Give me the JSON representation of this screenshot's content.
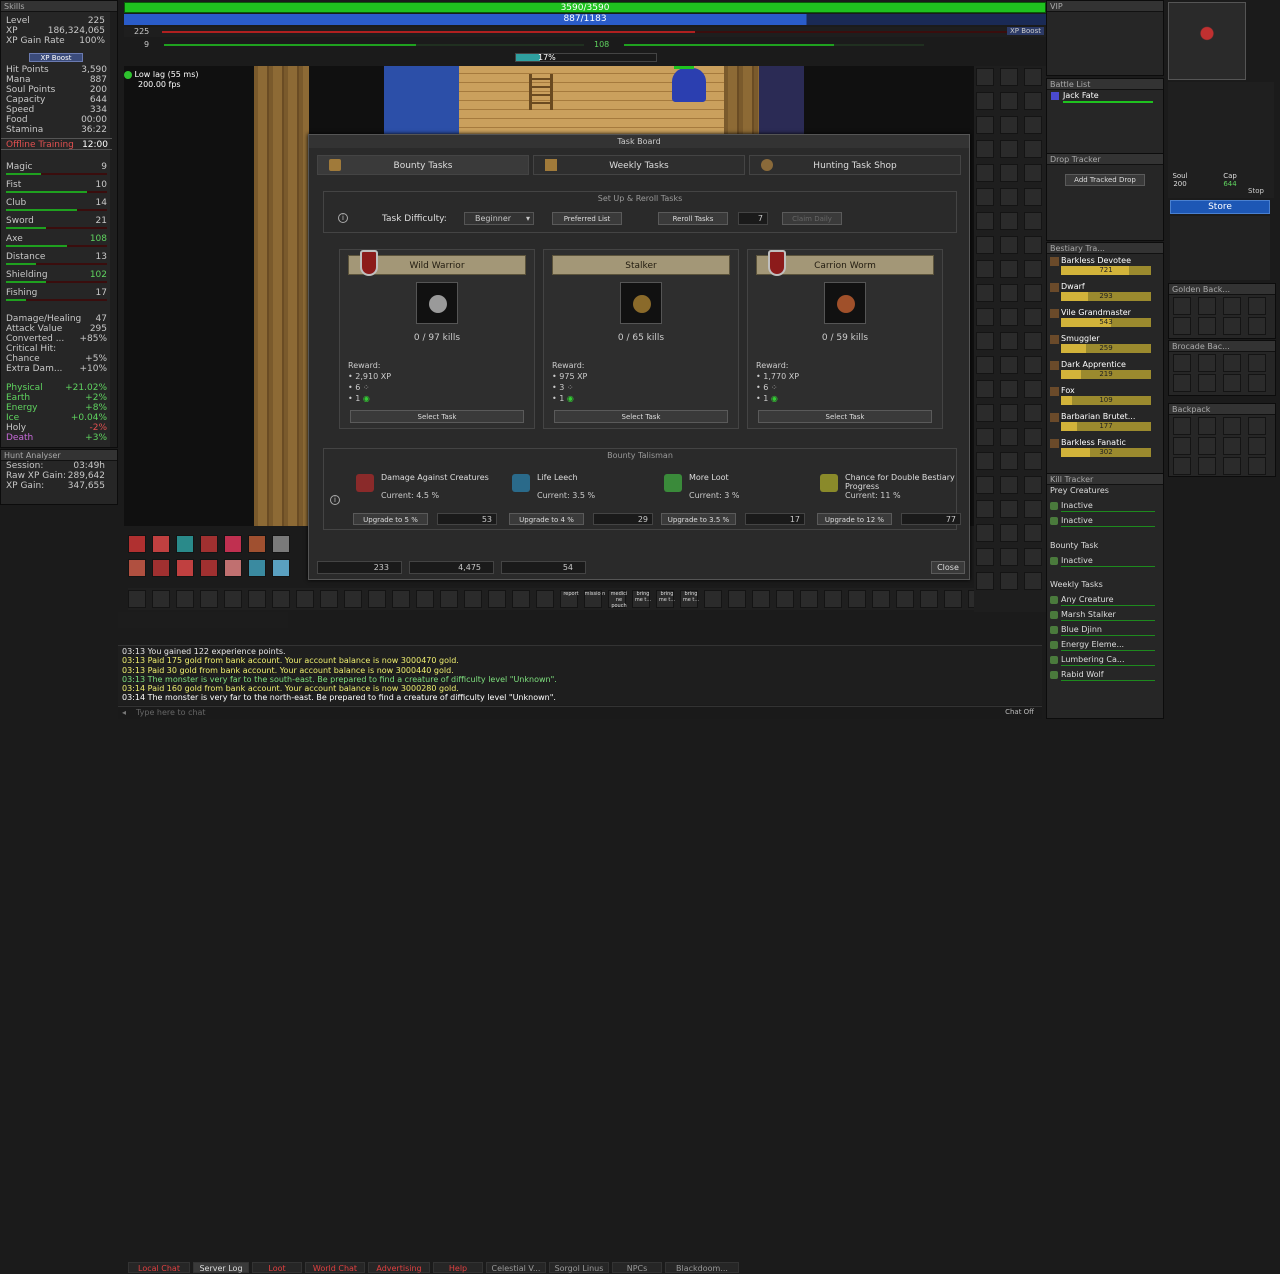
{
  "skills": {
    "title": "Skills",
    "top": [
      {
        "k": "Level",
        "v": "225"
      },
      {
        "k": "XP",
        "v": "186,324,065"
      },
      {
        "k": "XP Gain Rate",
        "v": "100%"
      }
    ],
    "xp_boost": "XP Boost",
    "stats": [
      {
        "k": "Hit Points",
        "v": "3,590"
      },
      {
        "k": "Mana",
        "v": "887"
      },
      {
        "k": "Soul Points",
        "v": "200"
      },
      {
        "k": "Capacity",
        "v": "644"
      },
      {
        "k": "Speed",
        "v": "334"
      },
      {
        "k": "Food",
        "v": "00:00"
      },
      {
        "k": "Stamina",
        "v": "36:22"
      }
    ],
    "offline": {
      "k": "Offline Training",
      "v": "12:00"
    },
    "fighting": [
      {
        "k": "Magic",
        "v": "9",
        "p": 0.35
      },
      {
        "k": "Fist",
        "v": "10",
        "p": 0.8
      },
      {
        "k": "Club",
        "v": "14",
        "p": 0.7
      },
      {
        "k": "Sword",
        "v": "21",
        "p": 0.4
      },
      {
        "k": "Axe",
        "v": "108",
        "p": 0.6
      },
      {
        "k": "Distance",
        "v": "13",
        "p": 0.3
      },
      {
        "k": "Shielding",
        "v": "102",
        "p": 0.4
      },
      {
        "k": "Fishing",
        "v": "17",
        "p": 0.2
      }
    ],
    "combat": [
      {
        "k": "Damage/Healing",
        "v": "47"
      },
      {
        "k": "Attack Value",
        "v": "295"
      },
      {
        "k": "Converted ...",
        "v": "+85%"
      },
      {
        "k": "Critical Hit:",
        "v": ""
      },
      {
        "k": "  Chance",
        "v": "+5%"
      },
      {
        "k": "  Extra Dam...",
        "v": "+10%"
      }
    ],
    "resist": [
      {
        "k": "Physical",
        "v": "+21.02%"
      },
      {
        "k": "Earth",
        "v": "+2%"
      },
      {
        "k": "Energy",
        "v": "+8%"
      },
      {
        "k": "Ice",
        "v": "+0.04%"
      },
      {
        "k": "Holy",
        "v": "-2%"
      },
      {
        "k": "Death",
        "v": "+3%"
      }
    ]
  },
  "hunt": {
    "title": "Hunt Analyser",
    "rows": [
      {
        "k": "Session:",
        "v": "03:49h"
      },
      {
        "k": "Raw XP Gain:",
        "v": "289,642"
      },
      {
        "k": "XP Gain:",
        "v": "347,655"
      }
    ]
  },
  "bars": {
    "hp": "3590/3590",
    "mana": "887/1183",
    "level": "225",
    "skill": "9",
    "magic": "108",
    "percent": "17%",
    "xp_boost": "XP Boost",
    "vip": "VIP"
  },
  "status": {
    "lag": "Low lag (55 ms)",
    "fps": "200.00 fps"
  },
  "taskboard": {
    "title": "Task Board",
    "tabs": [
      "Bounty Tasks",
      "Weekly Tasks",
      "Hunting Task Shop"
    ],
    "setup_title": "Set Up & Reroll Tasks",
    "difficulty_label": "Task Difficulty:",
    "difficulty": "Beginner",
    "preferred": "Preferred List",
    "reroll": "Reroll Tasks",
    "reroll_count": "7",
    "claim": "Claim Daily",
    "reward_label": "Reward:",
    "select": "Select Task",
    "cards": [
      {
        "name": "Wild Warrior",
        "kills": "0 / 97 kills",
        "xp": "2,910 XP",
        "a": "6",
        "b": "1",
        "color": "#9a9a9a"
      },
      {
        "name": "Stalker",
        "kills": "0 / 65 kills",
        "xp": "975 XP",
        "a": "3",
        "b": "1",
        "color": "#8a6a2a"
      },
      {
        "name": "Carrion Worm",
        "kills": "0 / 59 kills",
        "xp": "1,770 XP",
        "a": "6",
        "b": "1",
        "color": "#a0502a"
      }
    ],
    "talisman_title": "Bounty Talisman",
    "talismans": [
      {
        "name": "Damage Against Creatures",
        "cur": "Current: 4.5 %",
        "up": "Upgrade to 5 %",
        "cost": "53",
        "color": "#8a2a2a"
      },
      {
        "name": "Life Leech",
        "cur": "Current: 3.5 %",
        "up": "Upgrade to 4 %",
        "cost": "29",
        "color": "#2a6a8a"
      },
      {
        "name": "More Loot",
        "cur": "Current: 3 %",
        "up": "Upgrade to 3.5 %",
        "cost": "17",
        "color": "#3a8a3a"
      },
      {
        "name": "Chance for Double Bestiary Progress",
        "cur": "Current: 11 %",
        "up": "Upgrade to 12 %",
        "cost": "77",
        "color": "#8a8a2a"
      }
    ],
    "footer": [
      "233",
      "4,475",
      "54"
    ],
    "close": "Close"
  },
  "battle": {
    "title": "Battle List",
    "entries": [
      "Jack Fate"
    ]
  },
  "drop": {
    "title": "Drop Tracker",
    "button": "Add Tracked Drop"
  },
  "bestiary": {
    "title": "Bestiary Tra...",
    "entries": [
      {
        "n": "Barkless Devotee",
        "v": "721",
        "p": 0.75
      },
      {
        "n": "Dwarf",
        "v": "293",
        "p": 0.3
      },
      {
        "n": "Vile Grandmaster",
        "v": "543",
        "p": 0.55
      },
      {
        "n": "Smuggler",
        "v": "259",
        "p": 0.28
      },
      {
        "n": "Dark Apprentice",
        "v": "219",
        "p": 0.22
      },
      {
        "n": "Fox",
        "v": "109",
        "p": 0.12
      },
      {
        "n": "Barbarian Brutet...",
        "v": "177",
        "p": 0.18
      },
      {
        "n": "Barkless Fanatic",
        "v": "302",
        "p": 0.32
      }
    ]
  },
  "killtracker": {
    "title": "Kill Tracker",
    "prey_title": "Prey Creatures",
    "prey": [
      "Inactive",
      "Inactive"
    ],
    "bounty_title": "Bounty Task",
    "bounty": [
      "Inactive"
    ],
    "weekly_title": "Weekly Tasks",
    "weekly": [
      "Any Creature",
      "Marsh Stalker",
      "Blue Djinn",
      "Energy Eleme...",
      "Lumbering Ca...",
      "Rabid Wolf"
    ]
  },
  "store": "Store",
  "stop": "Stop",
  "soul": {
    "label": "Soul",
    "v": "200"
  },
  "cap": {
    "label": "Cap",
    "v": "644"
  },
  "containers": [
    "Golden Back...",
    "Brocade Bac...",
    "Backpack"
  ],
  "hotkeys": [
    "report",
    "missio n",
    "medici ne pouch",
    "bring me t...",
    "bring me t...",
    "bring me t..."
  ],
  "chat": {
    "tabs": [
      "Local Chat",
      "Server Log",
      "Loot",
      "World Chat",
      "Advertising",
      "Help",
      "Celestial V...",
      "Sorgol Linus",
      "NPCs",
      "Blackdoom..."
    ],
    "lines": [
      {
        "t": "03:13 You gained 122 experience points.",
        "c": "#e6e6e6"
      },
      {
        "t": "03:13 Paid 175 gold from bank account. Your account balance is now 3000470 gold.",
        "c": "#f0f070"
      },
      {
        "t": "03:13 Paid 30 gold from bank account. Your account balance is now 3000440 gold.",
        "c": "#f0f070"
      },
      {
        "t": "03:13 The monster is very far to the south-east. Be prepared to find a creature of difficulty level \"Unknown\".",
        "c": "#7ee07e"
      },
      {
        "t": "03:14 Paid 160 gold from bank account. Your account balance is now 3000280 gold.",
        "c": "#f0f070"
      },
      {
        "t": "03:14 The monster is very far to the north-east. Be prepared to find a creature of difficulty level \"Unknown\".",
        "c": "#ffffff"
      }
    ],
    "placeholder": "Type here to chat",
    "chat_off": "Chat Off"
  }
}
